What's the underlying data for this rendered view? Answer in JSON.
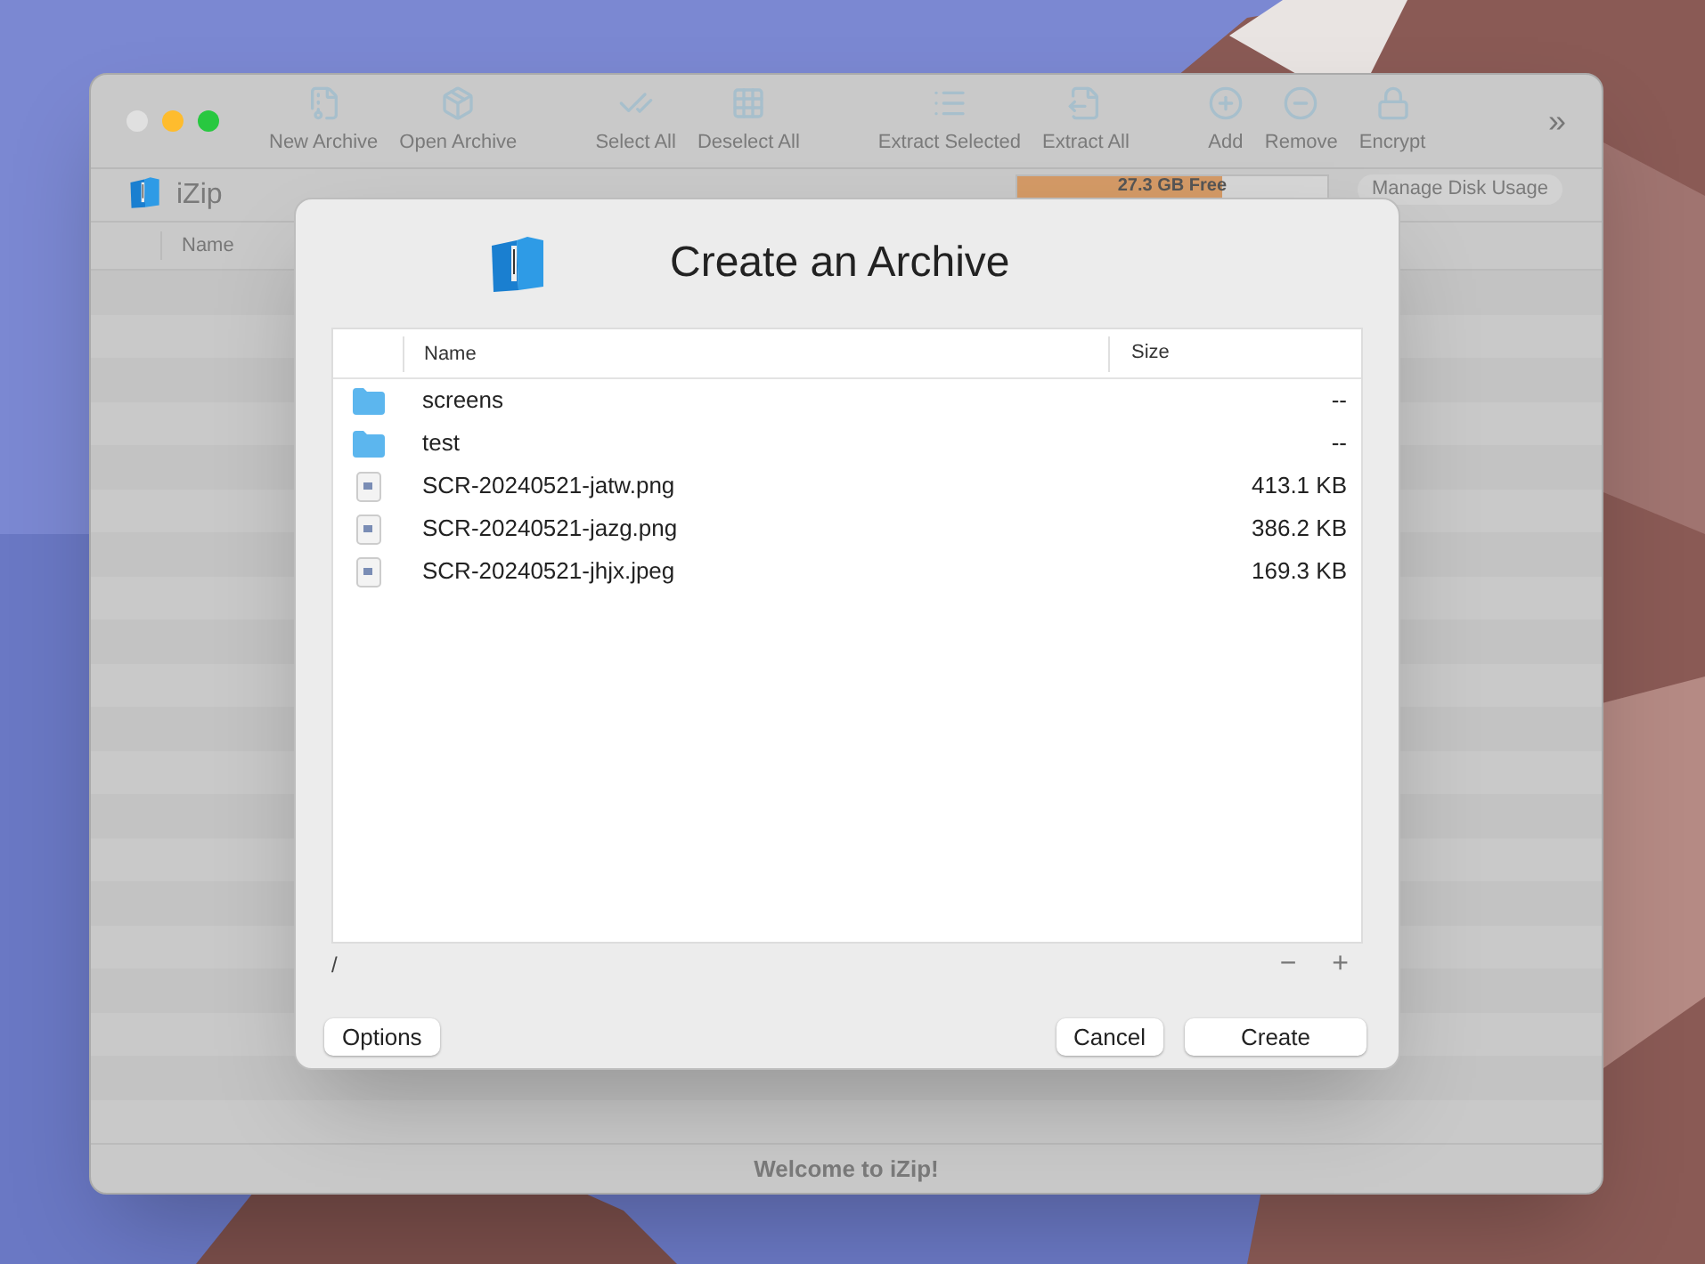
{
  "window": {
    "traffic_lights": [
      {
        "color": "#e0e0e0"
      },
      {
        "color": "#febc2e"
      },
      {
        "color": "#28c840"
      }
    ],
    "toolbar": [
      {
        "kind": "new",
        "label": "New Archive"
      },
      {
        "kind": "open",
        "label": "Open Archive"
      },
      {
        "kind": "select",
        "label": "Select All"
      },
      {
        "kind": "deselect",
        "label": "Deselect All"
      },
      {
        "kind": "extract-selected",
        "label": "Extract Selected"
      },
      {
        "kind": "extract-all",
        "label": "Extract All"
      },
      {
        "kind": "add",
        "label": "Add"
      },
      {
        "kind": "remove",
        "label": "Remove"
      },
      {
        "kind": "encrypt",
        "label": "Encrypt"
      }
    ],
    "overflow": "»",
    "app_name": "iZip",
    "disk": {
      "label": "27.3 GB Free",
      "level": 0.66
    },
    "manage_button": "Manage Disk Usage",
    "columns": [
      "Name"
    ],
    "status_bar": "Welcome to iZip!"
  },
  "dialog": {
    "title": "Create an Archive",
    "columns": [
      "Name",
      "Size"
    ],
    "rows": [
      {
        "kind": "folder",
        "name": "screens",
        "size": "--"
      },
      {
        "kind": "folder",
        "name": "test",
        "size": "--"
      },
      {
        "kind": "file",
        "name": "SCR-20240521-jatw.png",
        "size": "413.1 KB"
      },
      {
        "kind": "file",
        "name": "SCR-20240521-jazg.png",
        "size": "386.2 KB"
      },
      {
        "kind": "file",
        "name": "SCR-20240521-jhjx.jpeg",
        "size": "169.3 KB"
      }
    ],
    "path": "/",
    "remove": "−",
    "add": "+",
    "buttons": {
      "options": "Options",
      "cancel": "Cancel",
      "create": "Create"
    }
  }
}
